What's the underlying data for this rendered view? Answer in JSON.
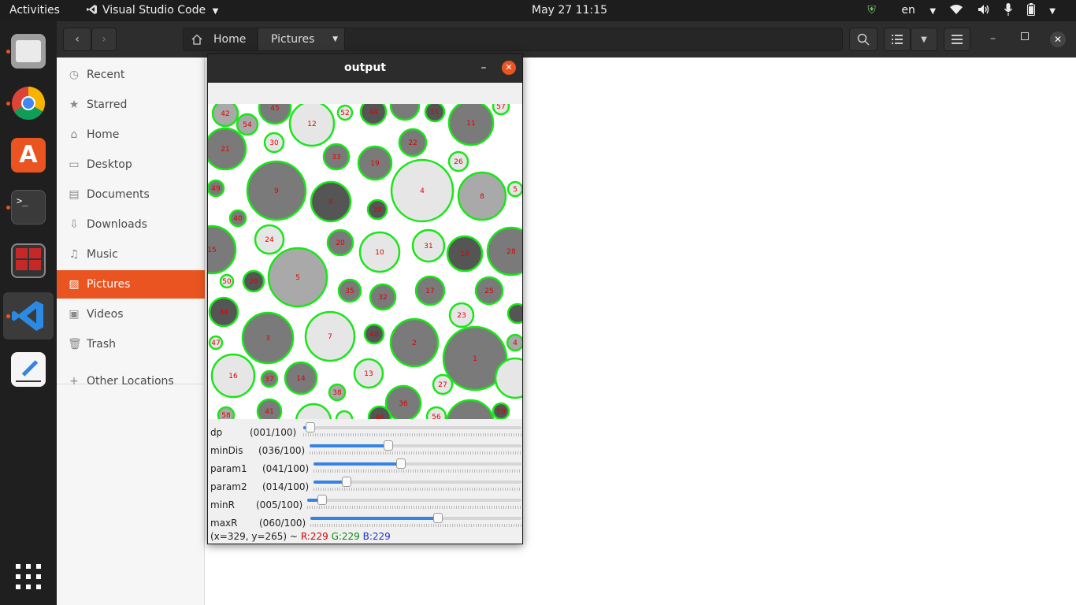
{
  "topbar": {
    "activities": "Activities",
    "app_name": "Visual Studio Code",
    "clock": "May 27  11:15",
    "language": "en"
  },
  "dock": {
    "items": [
      {
        "name": "files",
        "icon": "files-icon"
      },
      {
        "name": "chrome",
        "icon": "chrome-icon"
      },
      {
        "name": "software",
        "icon": "software-center-icon"
      },
      {
        "name": "terminal",
        "icon": "terminal-icon"
      },
      {
        "name": "remote",
        "icon": "remote-desktop-icon"
      },
      {
        "name": "vscode",
        "icon": "vscode-icon"
      },
      {
        "name": "editor",
        "icon": "text-editor-icon"
      }
    ],
    "apps_grid": "show-applications-icon"
  },
  "files": {
    "path": [
      "Home",
      "Pictures"
    ],
    "sidebar": [
      {
        "label": "Recent",
        "icon": "clock-icon"
      },
      {
        "label": "Starred",
        "icon": "star-icon"
      },
      {
        "label": "Home",
        "icon": "home-icon"
      },
      {
        "label": "Desktop",
        "icon": "desktop-icon"
      },
      {
        "label": "Documents",
        "icon": "document-icon"
      },
      {
        "label": "Downloads",
        "icon": "download-icon"
      },
      {
        "label": "Music",
        "icon": "music-icon"
      },
      {
        "label": "Pictures",
        "icon": "picture-icon",
        "selected": true
      },
      {
        "label": "Videos",
        "icon": "video-icon"
      },
      {
        "label": "Trash",
        "icon": "trash-icon"
      },
      {
        "label": "Other Locations",
        "icon": "plus-icon"
      }
    ]
  },
  "cv_window": {
    "title": "output",
    "trackbars": [
      {
        "name": "dp",
        "value_text": "(001/100)",
        "value": 1,
        "max": 100
      },
      {
        "name": "minDis",
        "value_text": "(036/100)",
        "value": 36,
        "max": 100
      },
      {
        "name": "param1",
        "value_text": "(041/100)",
        "value": 41,
        "max": 100
      },
      {
        "name": "param2",
        "value_text": "(014/100)",
        "value": 14,
        "max": 100
      },
      {
        "name": "minR",
        "value_text": "(005/100)",
        "value": 5,
        "max": 100
      },
      {
        "name": "maxR",
        "value_text": "(060/100)",
        "value": 60,
        "max": 100
      }
    ],
    "status": {
      "coords": "(x=329, y=265) ~",
      "r": "R:229",
      "g": "G:229",
      "b": "B:229"
    }
  }
}
